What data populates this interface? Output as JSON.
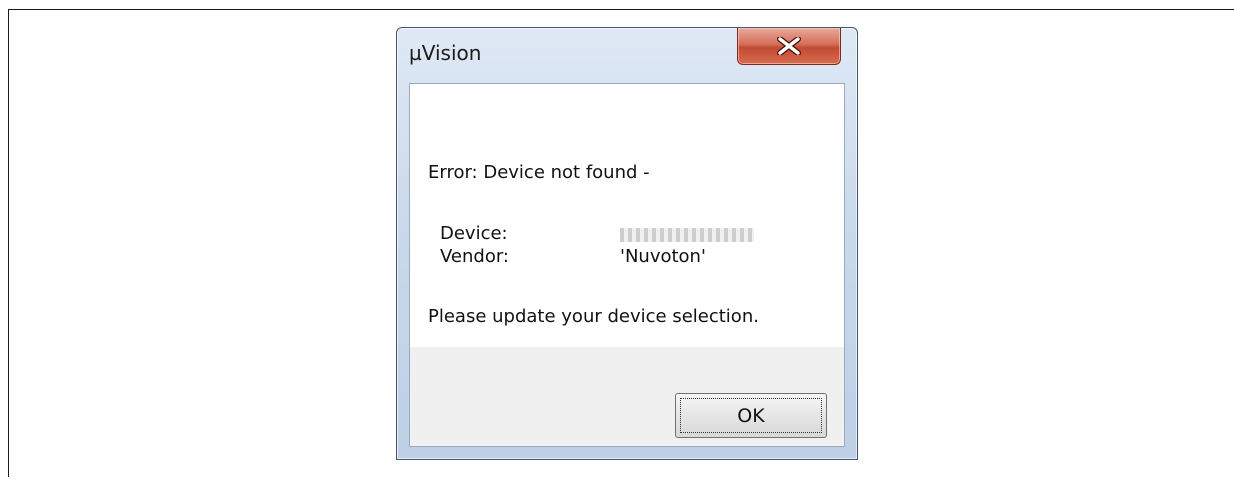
{
  "window": {
    "title": "µVision"
  },
  "message": {
    "error_line": "Error: Device not found -",
    "device_label": "Device:",
    "vendor_label": "Vendor:",
    "vendor_value": "'Nuvoton'",
    "update_line": "Please update your device selection."
  },
  "buttons": {
    "ok_label": "OK"
  },
  "icons": {
    "close": "close-icon"
  },
  "colors": {
    "close_button": "#c9533a",
    "title_bar": "#cad9ec",
    "footer": "#f0f0f0"
  }
}
